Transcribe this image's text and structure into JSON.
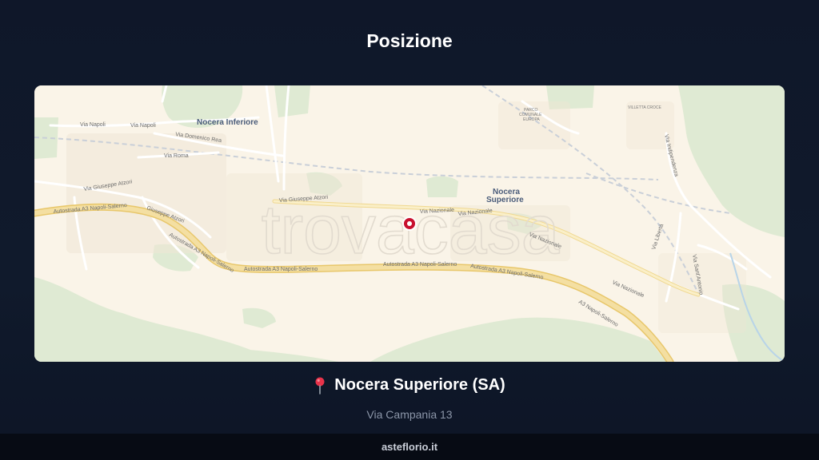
{
  "header": {
    "title": "Posizione"
  },
  "map": {
    "watermark": "trovacasa",
    "marker_icon": "map-marker-icon",
    "labels": {
      "nocera_inferiore": "Nocera Inferiore",
      "nocera_superiore_1": "Nocera",
      "nocera_superiore_2": "Superiore",
      "via_napoli_1": "Via Napoli",
      "via_napoli_2": "Via Napoli",
      "via_domenico_rea": "Via Domenico Rea",
      "via_roma": "Via Roma",
      "via_giuseppe_atzori_1": "Via Giuseppe Atzori",
      "via_giuseppe_atzori_2": "Giuseppe Atzori",
      "via_giuseppe_atzori_3": "Via Giuseppe Atzori",
      "via_nazionale_1": "Via Nazionale",
      "via_nazionale_2": "Via Nazionale",
      "via_nazionale_3": "Via Nazionale",
      "via_nazionale_4": "Via Nazionale",
      "autostrada_1": "Autostrada A3 Napoli-Salerno",
      "autostrada_2": "Autostrada A3 Napoli-Salerno",
      "autostrada_3": "Autostrada A3 Napoli-Salerno",
      "autostrada_4": "Autostrada A3 Napoli-Salerno",
      "autostrada_5": "Autostrada A3 Napoli-Salerno",
      "autostrada_6": "A3 Napoli-Salerno",
      "via_indipendenza": "Via Indipendenza",
      "via_liberta": "Via Libertà",
      "via_santantonio": "Via Sant'Antonio",
      "parco_1": "PARCO",
      "parco_2": "COMUNALE",
      "parco_3": "EUROPA",
      "villetta_croce": "VILLETTA CROCE"
    },
    "colors": {
      "land": "#faf4e8",
      "green": "#dfead3",
      "motorway": "#f4dfa2",
      "road": "#fdfaf2",
      "marker": "#c8102e"
    }
  },
  "location": {
    "pin_icon": "round-pushpin-icon",
    "city": "Nocera Superiore (SA)",
    "address": "Via Campania 13"
  },
  "footer": {
    "site": "asteflorio.it"
  }
}
